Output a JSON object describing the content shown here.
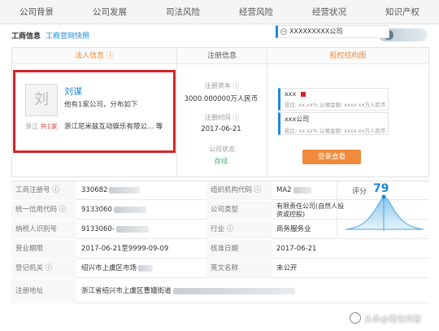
{
  "tabs": [
    "公司背景",
    "公司发展",
    "司法风险",
    "经营风险",
    "经营状况",
    "知识产权"
  ],
  "header": {
    "section_title": "工商信息",
    "snapshot_link": "工商官网快照"
  },
  "panel": {
    "legal_header": "法人信息 ⓘ",
    "register_header": "注册信息",
    "equity_header": "股权结构图"
  },
  "legal_person": {
    "avatar_char": "刘",
    "name": "刘谋",
    "info": "他有1家公司，分布如下",
    "location": "浙江",
    "count": "共1家",
    "company": "浙江尼米兹互动娱乐有限公... 等"
  },
  "register": {
    "capital_label": "注册资本 ⓘ",
    "capital_value": "3000.000000万人民币",
    "date_label": "注册时间 ⓘ",
    "date_value": "2017-06-21",
    "status_label": "公司状态",
    "status_value": "存续"
  },
  "equity": {
    "root": "XXXXXXXXX公司",
    "items": [
      {
        "name": "xxx",
        "line": "投比:  xx.xx%  认缴金额:  xxxx.xx万人民币"
      },
      {
        "name": "xxx公司",
        "line": "投比:  xx.xx%  认缴金额:  xxxx.xx万人民币"
      }
    ],
    "login_button": "登录查看"
  },
  "table": {
    "rows": [
      {
        "l1": "工商注册号 ⓘ",
        "v1": "330682",
        "l2": "组织机构代码 ⓘ",
        "v2": "MA2"
      },
      {
        "l1": "统一信用代码 ⓘ",
        "v1": "9133060",
        "l2": "公司类型",
        "v2": "有限责任公司(自然人投资或控股)"
      },
      {
        "l1": "纳税人识别号",
        "v1": "9133060-",
        "l2": "行业 ⓘ",
        "v2": "商务服务业"
      },
      {
        "l1": "营业期限",
        "v1": "2017-06-21至9999-09-09",
        "l2": "核准日期",
        "v2": "2017-06-21"
      },
      {
        "l1": "登记机关 ⓘ",
        "v1": "绍兴市上虞区市场",
        "l2": "英文名称",
        "v2": "未公开"
      },
      {
        "l1": "注册地址",
        "v1": "浙江省绍兴市上虞区曹娥街道",
        "l2": "",
        "v2": ""
      }
    ]
  },
  "score": {
    "label": "评分",
    "value": "79"
  },
  "watermark": "头条@悟空问答"
}
